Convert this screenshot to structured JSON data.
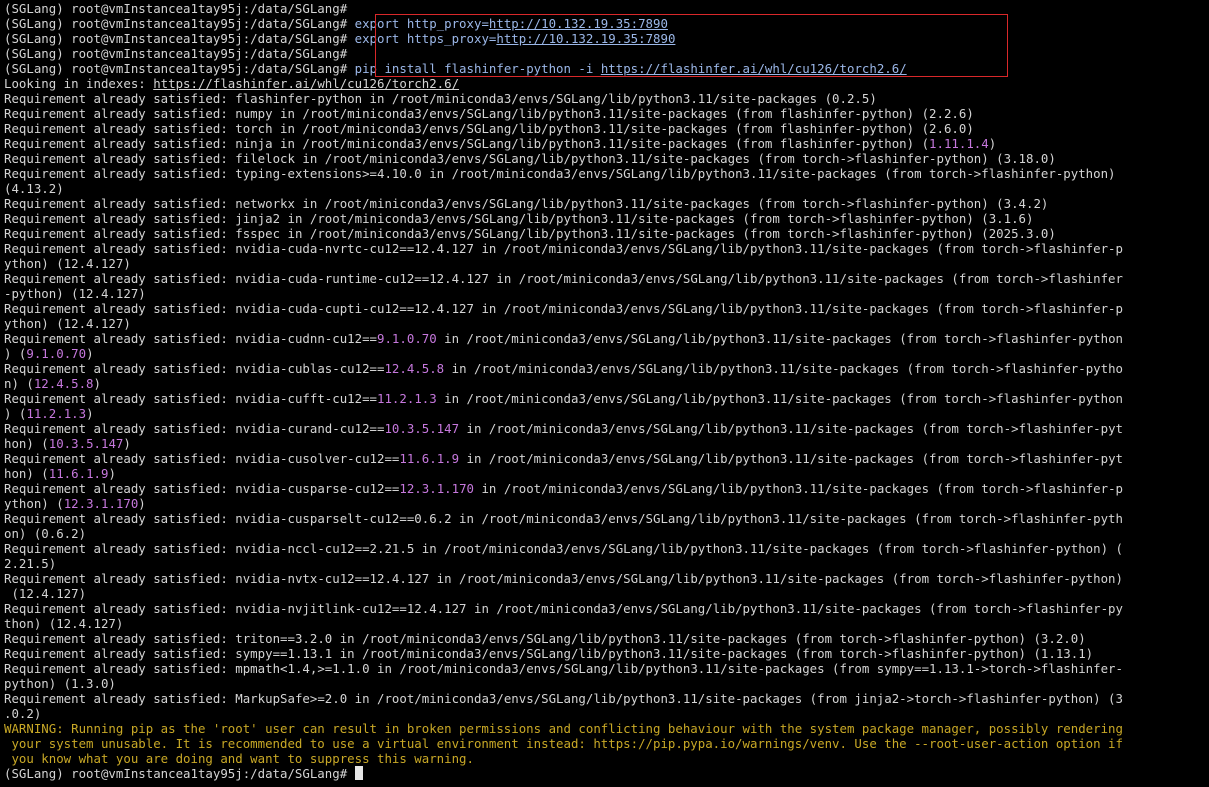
{
  "terminal": {
    "prompt": "(SGLang) root@vmInstancea1tay95j:/data/SGLang#",
    "commands": {
      "export_http": "export http_proxy=",
      "http_proxy_url": "http://10.132.19.35:7890",
      "export_https": "export https_proxy=",
      "https_proxy_url": "http://10.132.19.35:7890",
      "pip_install": "pip install flashinfer-python -i ",
      "index_url": "https://flashinfer.ai/whl/cu126/torch2.6/"
    },
    "looking_prefix": "Looking in indexes: ",
    "looking_url": "https://flashinfer.ai/whl/cu126/torch2.6/",
    "req_prefix": "Requirement already satisfied: ",
    "output_lines": [
      "flashinfer-python in /root/miniconda3/envs/SGLang/lib/python3.11/site-packages (0.2.5)",
      "numpy in /root/miniconda3/envs/SGLang/lib/python3.11/site-packages (from flashinfer-python) (2.2.6)",
      "torch in /root/miniconda3/envs/SGLang/lib/python3.11/site-packages (from flashinfer-python) (2.6.0)",
      "ninja in /root/miniconda3/envs/SGLang/lib/python3.11/site-packages (from flashinfer-python) ",
      "filelock in /root/miniconda3/envs/SGLang/lib/python3.11/site-packages (from torch->flashinfer-python) (3.18.0)",
      "typing-extensions>=4.10.0 in /root/miniconda3/envs/SGLang/lib/python3.11/site-packages (from torch->flashinfer-python)",
      "(4.13.2)",
      "networkx in /root/miniconda3/envs/SGLang/lib/python3.11/site-packages (from torch->flashinfer-python) (3.4.2)",
      "jinja2 in /root/miniconda3/envs/SGLang/lib/python3.11/site-packages (from torch->flashinfer-python) (3.1.6)",
      "fsspec in /root/miniconda3/envs/SGLang/lib/python3.11/site-packages (from torch->flashinfer-python) (2025.3.0)",
      "nvidia-cuda-nvrtc-cu12==12.4.127 in /root/miniconda3/envs/SGLang/lib/python3.11/site-packages (from torch->flashinfer-p",
      "ython) (12.4.127)",
      "nvidia-cuda-runtime-cu12==12.4.127 in /root/miniconda3/envs/SGLang/lib/python3.11/site-packages (from torch->flashinfer",
      "-python) (12.4.127)",
      "nvidia-cuda-cupti-cu12==12.4.127 in /root/miniconda3/envs/SGLang/lib/python3.11/site-packages (from torch->flashinfer-p",
      "ython) (12.4.127)",
      "nvidia-cudnn-cu12==",
      " in /root/miniconda3/envs/SGLang/lib/python3.11/site-packages (from torch->flashinfer-python",
      ") (",
      "nvidia-cublas-cu12==",
      " in /root/miniconda3/envs/SGLang/lib/python3.11/site-packages (from torch->flashinfer-pytho",
      "n) (",
      "nvidia-cufft-cu12==",
      " in /root/miniconda3/envs/SGLang/lib/python3.11/site-packages (from torch->flashinfer-python",
      ") (",
      "nvidia-curand-cu12==",
      " in /root/miniconda3/envs/SGLang/lib/python3.11/site-packages (from torch->flashinfer-pyt",
      "hon) (",
      "nvidia-cusolver-cu12==",
      " in /root/miniconda3/envs/SGLang/lib/python3.11/site-packages (from torch->flashinfer-pyt",
      "hon) (",
      "nvidia-cusparse-cu12==",
      " in /root/miniconda3/envs/SGLang/lib/python3.11/site-packages (from torch->flashinfer-p",
      "ython) (",
      "nvidia-cusparselt-cu12==0.6.2 in /root/miniconda3/envs/SGLang/lib/python3.11/site-packages (from torch->flashinfer-pyth",
      "on) (0.6.2)",
      "nvidia-nccl-cu12==2.21.5 in /root/miniconda3/envs/SGLang/lib/python3.11/site-packages (from torch->flashinfer-python) (",
      "2.21.5)",
      "nvidia-nvtx-cu12==12.4.127 in /root/miniconda3/envs/SGLang/lib/python3.11/site-packages (from torch->flashinfer-python)",
      " (12.4.127)",
      "nvidia-nvjitlink-cu12==12.4.127 in /root/miniconda3/envs/SGLang/lib/python3.11/site-packages (from torch->flashinfer-py",
      "thon) (12.4.127)",
      "triton==3.2.0 in /root/miniconda3/envs/SGLang/lib/python3.11/site-packages (from torch->flashinfer-python) (3.2.0)",
      "sympy==1.13.1 in /root/miniconda3/envs/SGLang/lib/python3.11/site-packages (from torch->flashinfer-python) (1.13.1)",
      "mpmath<1.4,>=1.1.0 in /root/miniconda3/envs/SGLang/lib/python3.11/site-packages (from sympy==1.13.1->torch->flashinfer-",
      "python) (1.3.0)",
      "MarkupSafe>=2.0 in /root/miniconda3/envs/SGLang/lib/python3.11/site-packages (from jinja2->torch->flashinfer-python) (3",
      ".0.2)"
    ],
    "highlights": {
      "ninja": "1.11.1.4",
      "cudnn": "9.1.0.70",
      "cublas": "12.4.5.8",
      "cufft": "11.2.1.3",
      "curand": "10.3.5.147",
      "cusolver": "11.6.1.9",
      "cusparse": "12.3.1.170"
    },
    "close_paren": ")",
    "warning_lines": [
      "WARNING: Running pip as the 'root' user can result in broken permissions and conflicting behaviour with the system package manager, possibly rendering",
      " your system unusable. It is recommended to use a virtual environment instead: https://pip.pypa.io/warnings/venv. Use the --root-user-action option if",
      " you know what you are doing and want to suppress this warning."
    ],
    "colors": {
      "background": "#000000",
      "text": "#d4d4d4",
      "highlight_version": "#c678dd",
      "warning": "#c8a826",
      "annotation_box": "#d9282a"
    }
  }
}
